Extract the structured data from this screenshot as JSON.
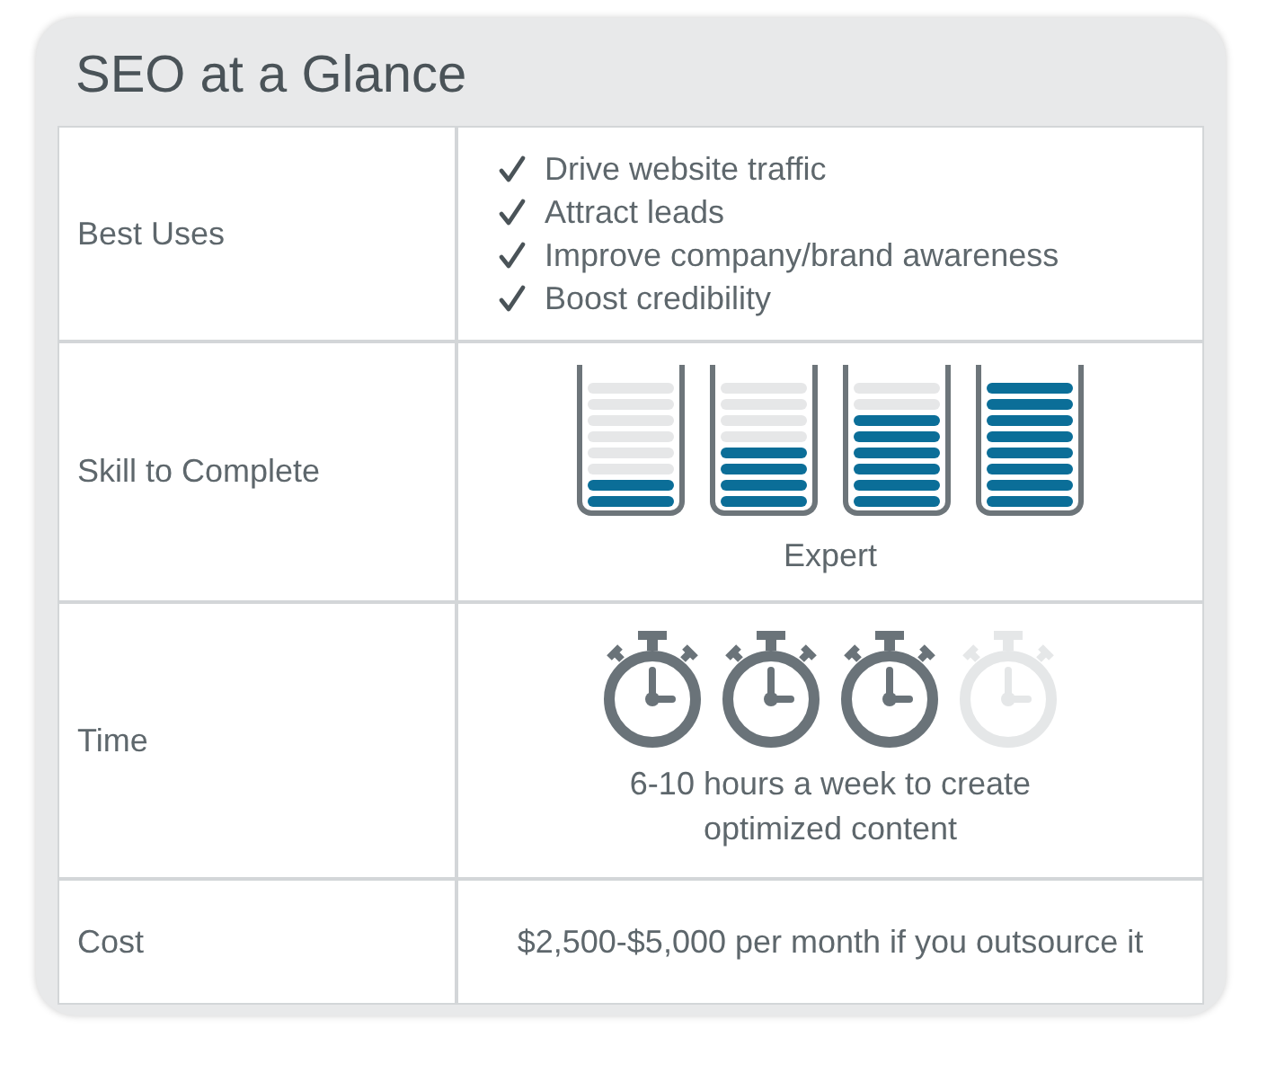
{
  "title": "SEO at a Glance",
  "rows": [
    {
      "kind": "list",
      "label": "Best Uses",
      "items": [
        "Drive website traffic",
        "Attract leads",
        "Improve company/brand awareness",
        "Boost credibility"
      ]
    },
    {
      "kind": "meters",
      "label": "Skill to Complete",
      "meters": [
        {
          "level": 0.25
        },
        {
          "level": 0.5
        },
        {
          "level": 0.75
        },
        {
          "level": 1
        }
      ],
      "caption": "Expert"
    },
    {
      "kind": "timers",
      "label": "Time",
      "timers": [
        {
          "on": true
        },
        {
          "on": true
        },
        {
          "on": true
        },
        {
          "on": false
        }
      ],
      "caption": "6-10 hours a week to create optimized content"
    },
    {
      "kind": "text",
      "label": "Cost",
      "value": "$2,500-$5,000 per month if you outsource it"
    }
  ]
}
